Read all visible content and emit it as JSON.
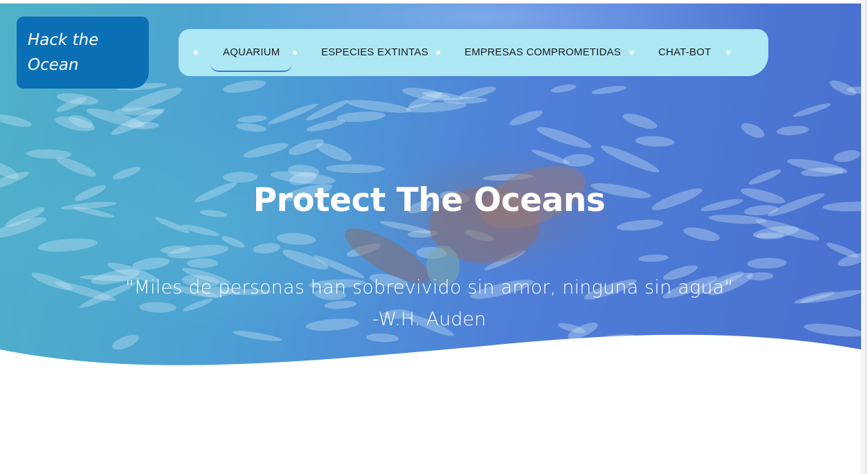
{
  "brand": {
    "line1": "Hack the",
    "line2": "Ocean"
  },
  "nav": {
    "items": [
      {
        "label": "AQUARIUM",
        "active": true
      },
      {
        "label": "ESPECIES EXTINTAS",
        "active": false
      },
      {
        "label": "EMPRESAS COMPROMETIDAS",
        "active": false
      },
      {
        "label": "CHAT-BOT",
        "active": false
      }
    ]
  },
  "hero": {
    "title": "Protect The Oceans",
    "quote": "\"Miles de personas han sobrevivido sin amor, ninguna sin agua\"",
    "author": "-W.H. Auden"
  },
  "colors": {
    "brand_box": "#0b6fb6",
    "nav_background": "#aee8f5",
    "active_underline": "#3a7fd6",
    "text_light": "#ffffff",
    "nav_text": "#1b1b1b"
  }
}
